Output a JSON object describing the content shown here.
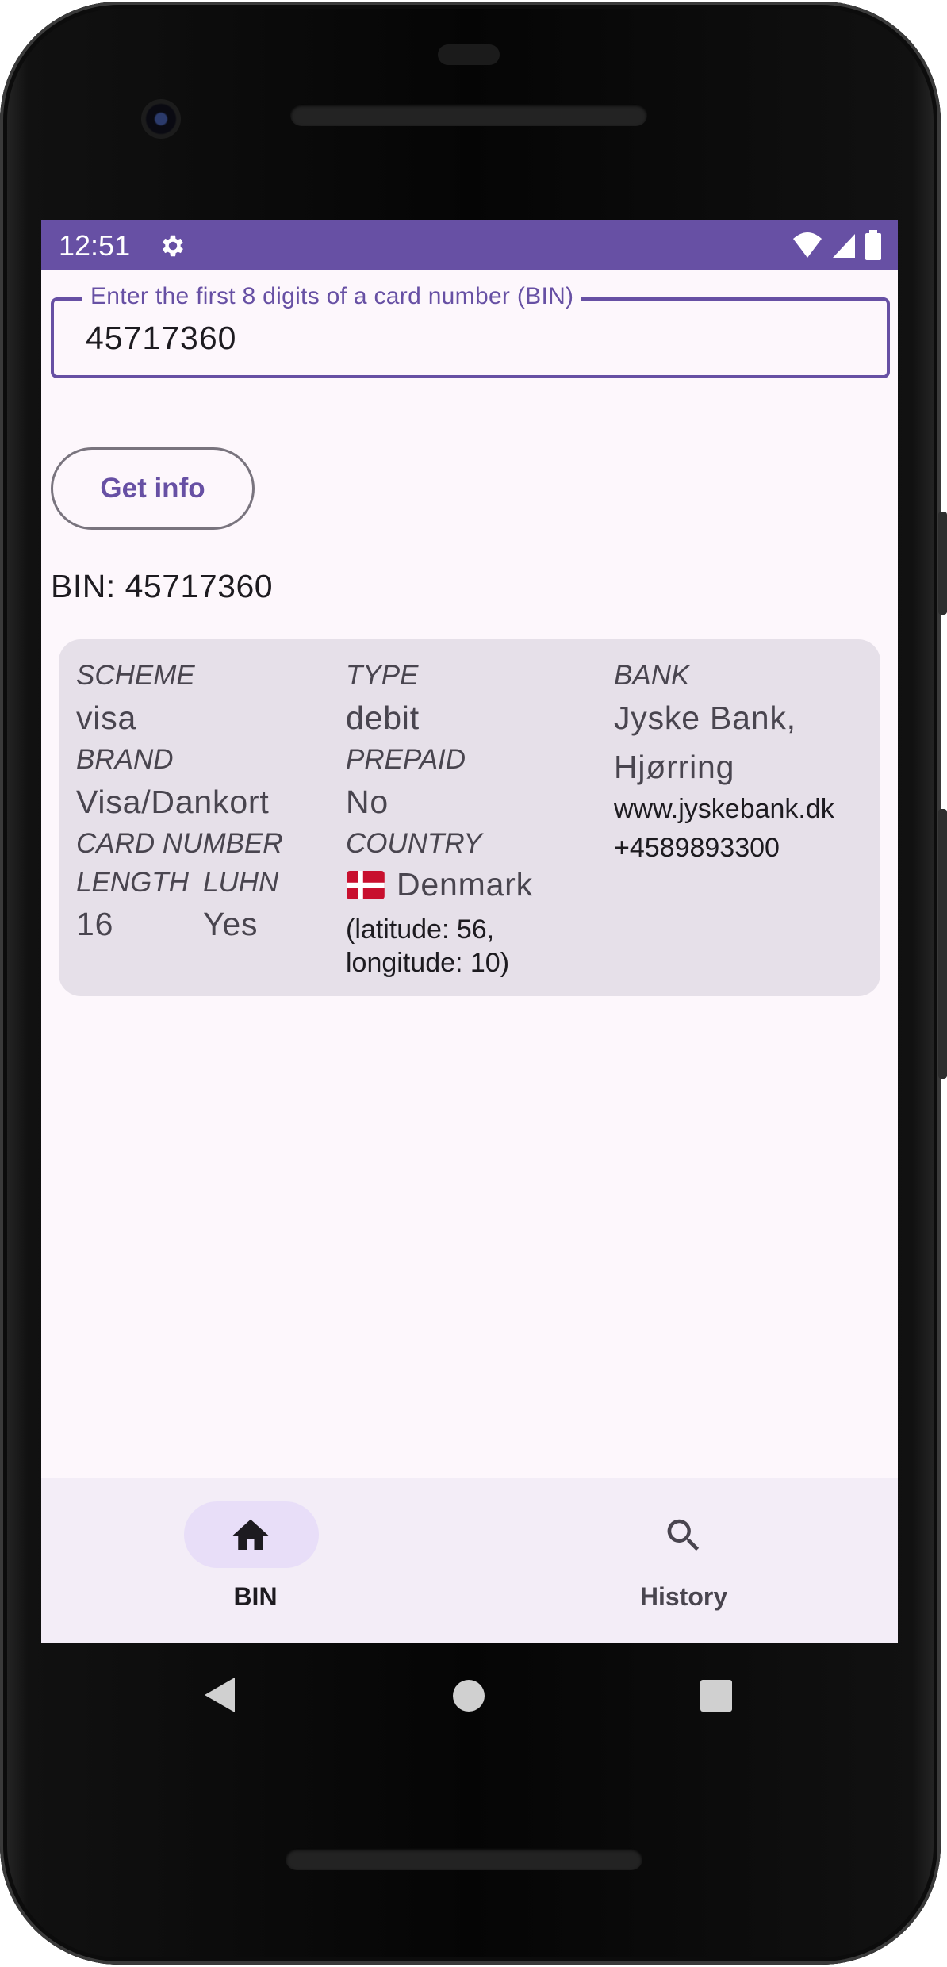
{
  "status_bar": {
    "time": "12:51",
    "icons": [
      "settings-icon",
      "wifi-icon",
      "cell-signal-icon",
      "battery-icon"
    ],
    "background": "#6750a4"
  },
  "bin_input": {
    "label": "Enter the first 8 digits of a card number (BIN)",
    "value": "45717360"
  },
  "get_info_button": {
    "label": "Get info"
  },
  "result": {
    "bin_line": "BIN: 45717360",
    "scheme": {
      "label": "SCHEME",
      "value": "visa"
    },
    "brand": {
      "label": "BRAND",
      "value": "Visa/Dankort"
    },
    "card_number": {
      "label": "CARD NUMBER",
      "length_label": "LENGTH",
      "length_value": "16",
      "luhn_label": "LUHN",
      "luhn_value": "Yes"
    },
    "type": {
      "label": "TYPE",
      "value": "debit"
    },
    "prepaid": {
      "label": "PREPAID",
      "value": "No"
    },
    "country": {
      "label": "COUNTRY",
      "flag": "🇩🇰",
      "name": "Denmark",
      "coords_line1": "(latitude: 56,",
      "coords_line2": "longitude: 10)"
    },
    "bank": {
      "label": "BANK",
      "name_line1": "Jyske Bank,",
      "name_line2": "Hjørring",
      "url": "www.jyskebank.dk",
      "phone": "+4589893300"
    }
  },
  "bottom_nav": {
    "items": [
      {
        "label": "BIN",
        "icon": "home-icon",
        "selected": true
      },
      {
        "label": "History",
        "icon": "search-icon",
        "selected": false
      }
    ]
  },
  "system_nav": {
    "icons": [
      "back-icon",
      "home-circle-icon",
      "recents-icon"
    ]
  },
  "colors": {
    "primary": "#6750a4",
    "surface": "#fdf7fc",
    "card": "#e6e0e9",
    "nav_bar": "#f3edf7",
    "nav_pill": "#e8def8"
  }
}
